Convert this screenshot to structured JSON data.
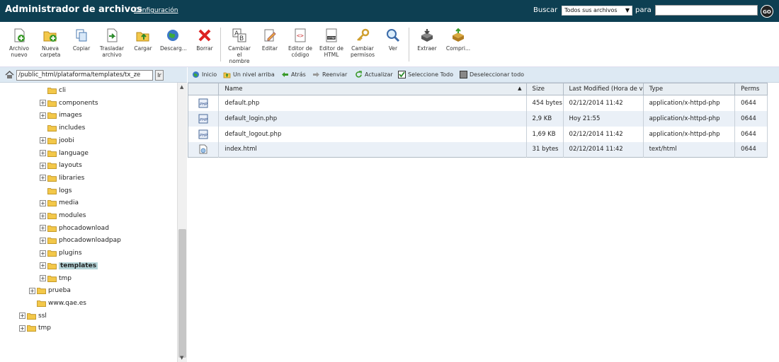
{
  "header": {
    "title": "Administrador de archivos",
    "config_link": "Configuración",
    "search_label": "Buscar",
    "search_scope": "Todos sus archivos",
    "para_label": "para",
    "search_value": "",
    "go_label": "GO"
  },
  "toolbar": {
    "archivo_nuevo": [
      "Archivo",
      "nuevo"
    ],
    "nueva_carpeta": [
      "Nueva",
      "carpeta"
    ],
    "copiar": "Copiar",
    "trasladar": [
      "Trasladar",
      "archivo"
    ],
    "cargar": "Cargar",
    "descargar": "Descarg...",
    "borrar": "Borrar",
    "cambiar_nombre": [
      "Cambiar",
      "el",
      "nombre"
    ],
    "editar": "Editar",
    "editor_codigo": [
      "Editor de",
      "código"
    ],
    "editor_html": [
      "Editor de",
      "HTML"
    ],
    "cambiar_permisos": [
      "Cambiar",
      "permisos"
    ],
    "ver": "Ver",
    "extraer": "Extraer",
    "comprimir": "Compri..."
  },
  "path": {
    "value": "public_html/plataforma/templates/tx_ze",
    "go_label": "Ir"
  },
  "tree": [
    {
      "label": "cli",
      "level": 4,
      "expandable": false
    },
    {
      "label": "components",
      "level": 4,
      "expandable": true
    },
    {
      "label": "images",
      "level": 4,
      "expandable": true
    },
    {
      "label": "includes",
      "level": 4,
      "expandable": false
    },
    {
      "label": "joobi",
      "level": 4,
      "expandable": true
    },
    {
      "label": "language",
      "level": 4,
      "expandable": true
    },
    {
      "label": "layouts",
      "level": 4,
      "expandable": true
    },
    {
      "label": "libraries",
      "level": 4,
      "expandable": true
    },
    {
      "label": "logs",
      "level": 4,
      "expandable": false
    },
    {
      "label": "media",
      "level": 4,
      "expandable": true
    },
    {
      "label": "modules",
      "level": 4,
      "expandable": true
    },
    {
      "label": "phocadownload",
      "level": 4,
      "expandable": true
    },
    {
      "label": "phocadownloadpap",
      "level": 4,
      "expandable": true
    },
    {
      "label": "plugins",
      "level": 4,
      "expandable": true
    },
    {
      "label": "templates",
      "level": 4,
      "expandable": true,
      "selected": true
    },
    {
      "label": "tmp",
      "level": 4,
      "expandable": true
    },
    {
      "label": "prueba",
      "level": 3,
      "expandable": true
    },
    {
      "label": "www.qae.es",
      "level": 3,
      "expandable": false
    },
    {
      "label": "ssl",
      "level": 2,
      "expandable": true
    },
    {
      "label": "tmp",
      "level": 2,
      "expandable": true
    }
  ],
  "actions": {
    "inicio": "Inicio",
    "nivel_arriba": "Un nivel arriba",
    "atras": "Atrás",
    "reenviar": "Reenviar",
    "actualizar": "Actualizar",
    "seleccione_todo": "Seleccione Todo",
    "deseleccionar_todo": "Deseleccionar todo"
  },
  "table": {
    "columns": {
      "name": "Name",
      "size": "Size",
      "modified": "Last Modified (Hora de v",
      "type": "Type",
      "perms": "Perms"
    },
    "rows": [
      {
        "icon": "php-file-icon",
        "name": "default.php",
        "size": "454 bytes",
        "modified": "02/12/2014 11:42",
        "type": "application/x-httpd-php",
        "perms": "0644"
      },
      {
        "icon": "php-file-icon",
        "name": "default_login.php",
        "size": "2,9 KB",
        "modified": "Hoy 21:55",
        "type": "application/x-httpd-php",
        "perms": "0644"
      },
      {
        "icon": "php-file-icon",
        "name": "default_logout.php",
        "size": "1,69 KB",
        "modified": "02/12/2014 11:42",
        "type": "application/x-httpd-php",
        "perms": "0644"
      },
      {
        "icon": "html-file-icon",
        "name": "index.html",
        "size": "31 bytes",
        "modified": "02/12/2014 11:42",
        "type": "text/html",
        "perms": "0644"
      }
    ]
  },
  "colors": {
    "header_bg": "#0d3f52",
    "toolbar_bg": "#ffffff",
    "pathbar_bg": "#dde9f3",
    "row_alt": "#eaf0f7",
    "selected_folder": "#b5d4d8"
  }
}
